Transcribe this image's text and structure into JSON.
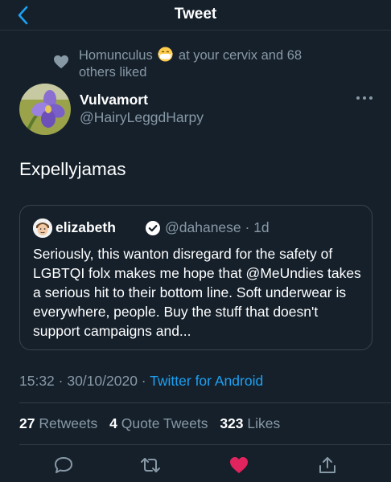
{
  "header": {
    "title": "Tweet"
  },
  "social_context": {
    "prefix": "Homunculus",
    "emoji": "face-with-medical-mask-emoji",
    "suffix_line1": "at your cervix and 68",
    "suffix_line2": "others liked"
  },
  "author": {
    "name": "Vulvamort",
    "handle": "@HairyLeggdHarpy",
    "avatar": "iris-flower-avatar"
  },
  "tweet": {
    "text": "Expellyjamas"
  },
  "quoted": {
    "name": "elizabeth",
    "verified": true,
    "handle_time": "@dahanese · 1d",
    "text": "Seriously, this wanton disregard for the safety of LGBTQI folx makes me hope that @MeUndies takes a serious hit to their bottom line. Soft underwear is everywhere, people. Buy the stuff that doesn't support campaigns and..."
  },
  "meta": {
    "timestamp": "15:32 · 30/10/2020 · ",
    "source": "Twitter for Android"
  },
  "stats": {
    "retweets_count": "27",
    "retweets_label": "Retweets",
    "quotes_count": "4",
    "quotes_label": "Quote Tweets",
    "likes_count": "323",
    "likes_label": "Likes"
  },
  "colors": {
    "background": "#15202b",
    "accent": "#1da1f2",
    "like": "#e0245e",
    "secondary_text": "#8899a6"
  }
}
